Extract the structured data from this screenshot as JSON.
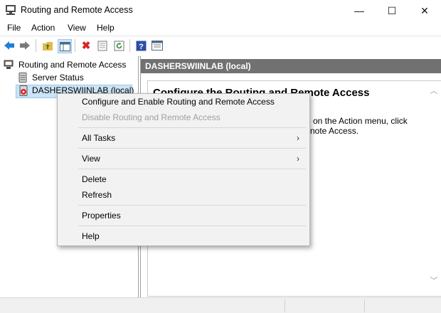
{
  "window": {
    "title": "Routing and Remote Access",
    "controls": {
      "minimize": "—",
      "maximize": "☐",
      "close": "✕"
    }
  },
  "menubar": {
    "items": [
      "File",
      "Action",
      "View",
      "Help"
    ]
  },
  "toolbar": {
    "icons": [
      "back-icon",
      "forward-icon",
      "up-folder-icon",
      "show-hide-tree-icon",
      "delete-icon",
      "properties-icon",
      "refresh-icon",
      "help-icon",
      "export-list-icon"
    ]
  },
  "tree": {
    "root": "Routing and Remote Access",
    "server_status": "Server Status",
    "host": "DASHERSWIINLAB (local)"
  },
  "right_pane": {
    "header": "DASHERSWIINLAB (local)",
    "heading": "Configure the Routing and Remote Access",
    "line1": "on the Action menu, click",
    "line2": "note Access."
  },
  "context_menu": {
    "configure": "Configure and Enable Routing and Remote Access",
    "disable": "Disable Routing and Remote Access",
    "all_tasks": "All Tasks",
    "view": "View",
    "delete": "Delete",
    "refresh": "Refresh",
    "properties": "Properties",
    "help": "Help",
    "submenu_arrow": "›"
  },
  "colors": {
    "header_bg": "#717171",
    "selection_bg": "#cce4f7",
    "menu_bg": "#f2f2f2",
    "disabled_text": "#a0a0a0"
  }
}
